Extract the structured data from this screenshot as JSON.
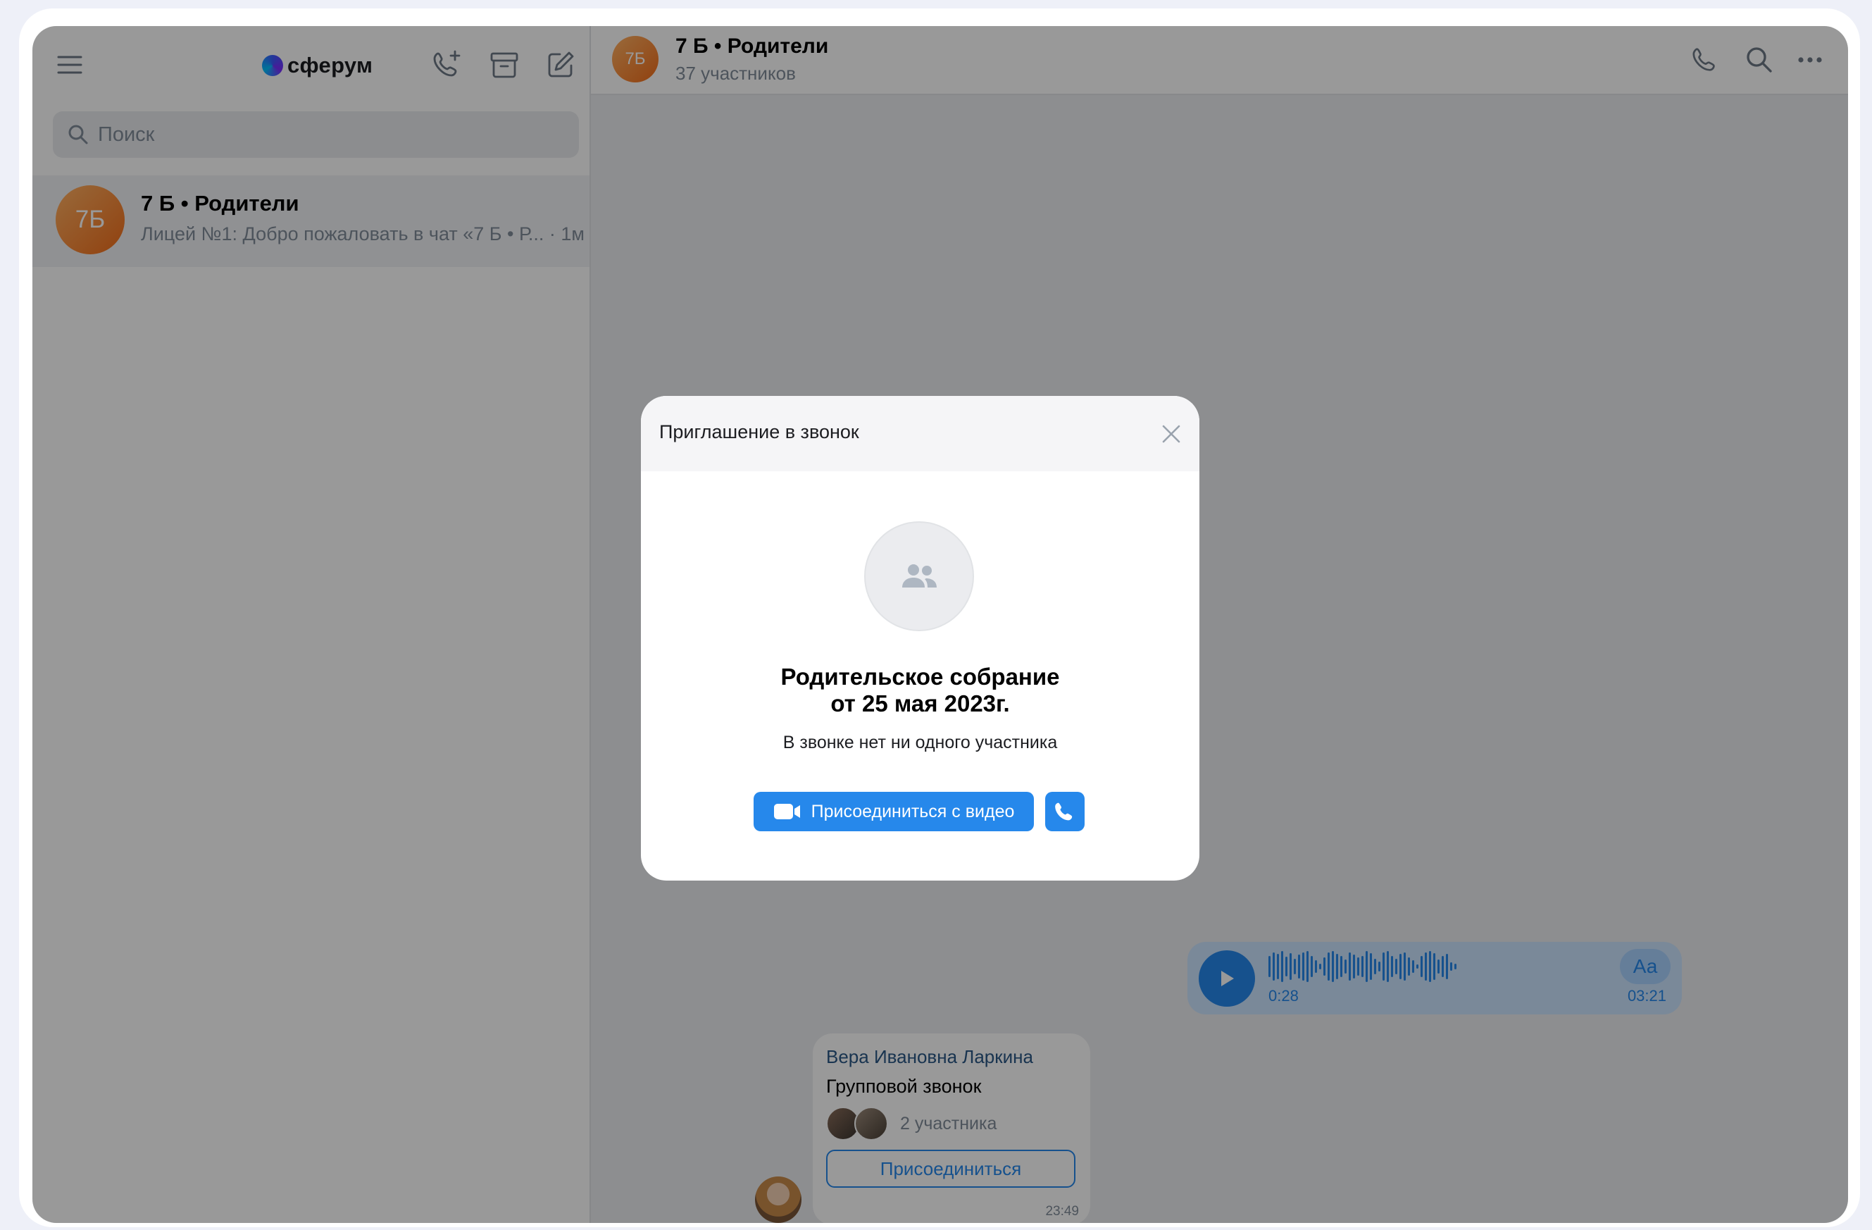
{
  "app": {
    "name": "сферум"
  },
  "sidebar": {
    "search_placeholder": "Поиск",
    "chats": [
      {
        "avatar": "7Б",
        "title": "7 Б • Родители",
        "snippet": "Лицей №1: Добро пожаловать в чат «7 Б • Р... · 1м"
      }
    ],
    "toolbar_icons": [
      "menu-icon",
      "add-call-icon",
      "archive-icon",
      "compose-icon"
    ]
  },
  "chat": {
    "avatar": "7Б",
    "title": "7 Б • Родители",
    "members": "37 участников",
    "header_icons": [
      "phone-icon",
      "search-icon",
      "more-icon"
    ],
    "voice_message": {
      "current_time": "0:28",
      "duration": "03:21",
      "transcribe_label": "Аа"
    },
    "call_message": {
      "author": "Вера Ивановна Ларкина",
      "type": "Групповой звонок",
      "participants": "2 участника",
      "join_label": "Присоединиться",
      "time": "23:49"
    }
  },
  "modal": {
    "title": "Приглашение в звонок",
    "call_title_line1": "Родительское собрание",
    "call_title_line2": "от 25 мая 2023г.",
    "status": "В звонке нет ни одного участника",
    "join_video_label": "Присоединиться с видео"
  },
  "colors": {
    "accent": "#2688eb",
    "avatar_orange": "#f26d1a",
    "overlay": "rgba(0,0,0,0.4)"
  }
}
